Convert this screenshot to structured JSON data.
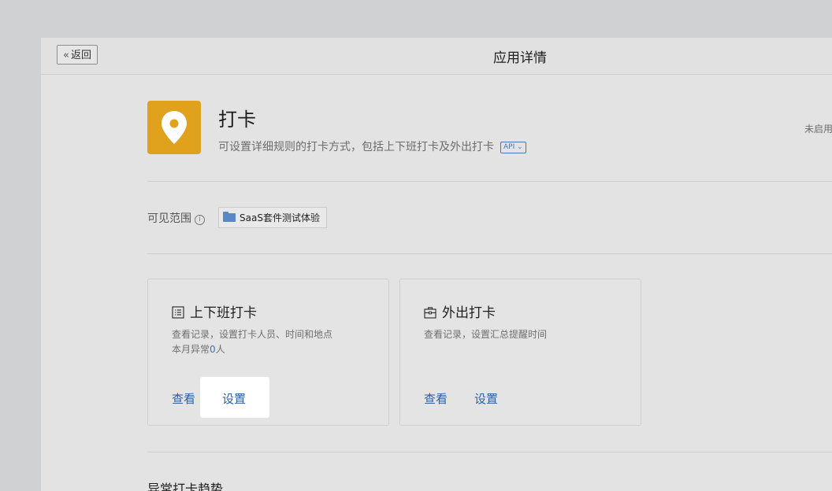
{
  "header": {
    "back_label": "返回",
    "title": "应用详情"
  },
  "app": {
    "icon": "location-pin-icon",
    "icon_bg_color": "#e0a11c",
    "name": "打卡",
    "description": "可设置详细规则的打卡方式，包括上下班打卡及外出打卡",
    "api_badge": "API",
    "status": "未启用"
  },
  "visibility": {
    "label": "可见范围",
    "scope": "SaaS套件测试体验"
  },
  "cards": [
    {
      "title": "上下班打卡",
      "icon": "list-icon",
      "desc_line1": "查看记录，设置打卡人员、时间和地点",
      "desc_line2_prefix": "本月异常",
      "desc_line2_count": "0",
      "desc_line2_suffix": "人",
      "view_label": "查看",
      "settings_label": "设置"
    },
    {
      "title": "外出打卡",
      "icon": "briefcase-icon",
      "desc_line1": "查看记录，设置汇总提醒时间",
      "view_label": "查看",
      "settings_label": "设置"
    }
  ],
  "section": {
    "heading": "异常打卡趋势"
  },
  "colors": {
    "link": "#2e5f9f",
    "accent": "#3f6fb3"
  }
}
